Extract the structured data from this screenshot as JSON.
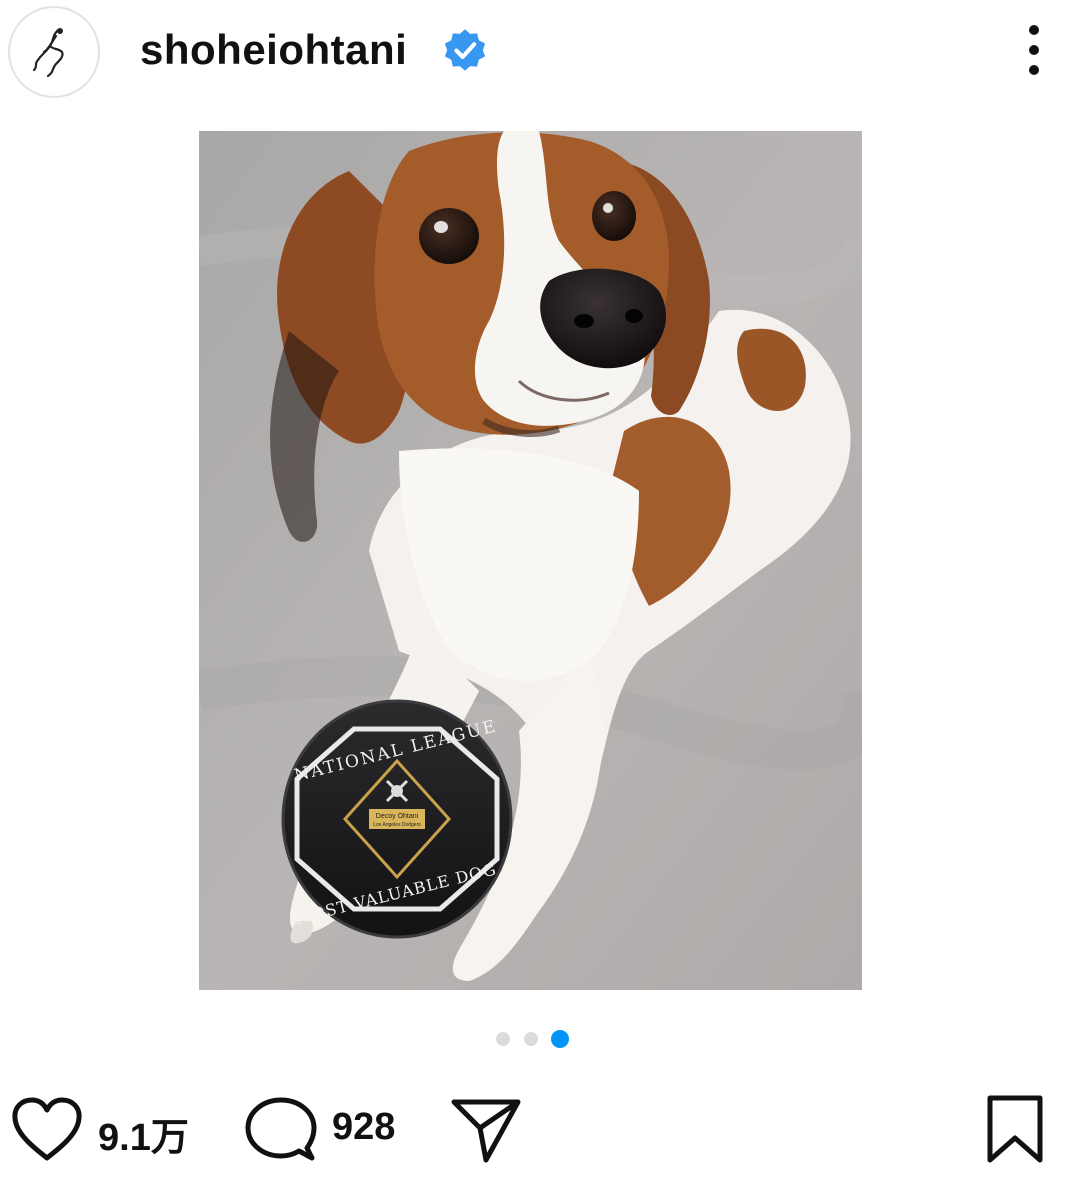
{
  "post": {
    "username": "shoheiohtani",
    "verified": true,
    "verified_color": "#3897f0"
  },
  "icons": {
    "avatar": "signature-logo",
    "verified": "verified-badge-icon",
    "more": "more-options-icon",
    "like": "heart-icon",
    "comment": "comment-icon",
    "share": "send-icon",
    "save": "bookmark-icon"
  },
  "photo": {
    "badge_top_text": "NATIONAL LEAGUE",
    "badge_bottom_text": "MOST VALUABLE DOG",
    "plate_name": "Decoy Ohtani",
    "plate_team": "Los Angeles Dodgers"
  },
  "carousel": {
    "total": 3,
    "active_index": 3,
    "active_color": "#0095f6",
    "inactive_color": "#dbdbdb"
  },
  "stats": {
    "likes": "9.1万",
    "comments": "928"
  }
}
